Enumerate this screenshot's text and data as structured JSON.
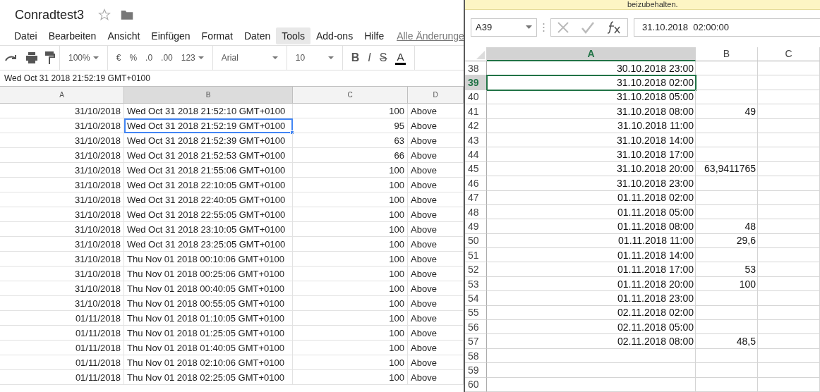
{
  "sheets": {
    "title": "Conradtest3",
    "menu": [
      {
        "label": "Datei",
        "selected": false
      },
      {
        "label": "Bearbeiten",
        "selected": false
      },
      {
        "label": "Ansicht",
        "selected": false
      },
      {
        "label": "Einfügen",
        "selected": false
      },
      {
        "label": "Format",
        "selected": false
      },
      {
        "label": "Daten",
        "selected": false
      },
      {
        "label": "Tools",
        "selected": true
      },
      {
        "label": "Add-ons",
        "selected": false
      },
      {
        "label": "Hilfe",
        "selected": false
      }
    ],
    "save_status": "Alle Änderunge",
    "toolbar": {
      "zoom": "100%",
      "currency": "€",
      "percent": "%",
      "decrease_decimals": ".0",
      "increase_decimals": ".00",
      "number_format": "123",
      "font": "Arial",
      "font_size": "10",
      "bold": "B",
      "italic": "I",
      "strike": "S",
      "text_color": "A"
    },
    "formula": "Wed Oct 31 2018 21:52:19 GMT+0100",
    "columns": [
      {
        "label": "A",
        "selected": false
      },
      {
        "label": "B",
        "selected": true
      },
      {
        "label": "C",
        "selected": false
      },
      {
        "label": "D",
        "selected": false
      }
    ],
    "rows": [
      {
        "cells": [
          "31/10/2018",
          "Wed Oct 31 2018 21:52:10 GMT+0100",
          "100",
          "Above"
        ],
        "selected": false
      },
      {
        "cells": [
          "31/10/2018",
          "Wed Oct 31 2018 21:52:19 GMT+0100",
          "95",
          "Above"
        ],
        "selected": true
      },
      {
        "cells": [
          "31/10/2018",
          "Wed Oct 31 2018 21:52:39 GMT+0100",
          "63",
          "Above"
        ],
        "selected": false
      },
      {
        "cells": [
          "31/10/2018",
          "Wed Oct 31 2018 21:52:53 GMT+0100",
          "66",
          "Above"
        ],
        "selected": false
      },
      {
        "cells": [
          "31/10/2018",
          "Wed Oct 31 2018 21:55:06 GMT+0100",
          "100",
          "Above"
        ],
        "selected": false
      },
      {
        "cells": [
          "31/10/2018",
          "Wed Oct 31 2018 22:10:05 GMT+0100",
          "100",
          "Above"
        ],
        "selected": false
      },
      {
        "cells": [
          "31/10/2018",
          "Wed Oct 31 2018 22:40:05 GMT+0100",
          "100",
          "Above"
        ],
        "selected": false
      },
      {
        "cells": [
          "31/10/2018",
          "Wed Oct 31 2018 22:55:05 GMT+0100",
          "100",
          "Above"
        ],
        "selected": false
      },
      {
        "cells": [
          "31/10/2018",
          "Wed Oct 31 2018 23:10:05 GMT+0100",
          "100",
          "Above"
        ],
        "selected": false
      },
      {
        "cells": [
          "31/10/2018",
          "Wed Oct 31 2018 23:25:05 GMT+0100",
          "100",
          "Above"
        ],
        "selected": false
      },
      {
        "cells": [
          "31/10/2018",
          "Thu Nov 01 2018 00:10:06 GMT+0100",
          "100",
          "Above"
        ],
        "selected": false
      },
      {
        "cells": [
          "31/10/2018",
          "Thu Nov 01 2018 00:25:06 GMT+0100",
          "100",
          "Above"
        ],
        "selected": false
      },
      {
        "cells": [
          "31/10/2018",
          "Thu Nov 01 2018 00:40:05 GMT+0100",
          "100",
          "Above"
        ],
        "selected": false
      },
      {
        "cells": [
          "31/10/2018",
          "Thu Nov 01 2018 00:55:05 GMT+0100",
          "100",
          "Above"
        ],
        "selected": false
      },
      {
        "cells": [
          "01/11/2018",
          "Thu Nov 01 2018 01:10:05 GMT+0100",
          "100",
          "Above"
        ],
        "selected": false
      },
      {
        "cells": [
          "01/11/2018",
          "Thu Nov 01 2018 01:25:05 GMT+0100",
          "100",
          "Above"
        ],
        "selected": false
      },
      {
        "cells": [
          "01/11/2018",
          "Thu Nov 01 2018 01:40:05 GMT+0100",
          "100",
          "Above"
        ],
        "selected": false
      },
      {
        "cells": [
          "01/11/2018",
          "Thu Nov 01 2018 02:10:06 GMT+0100",
          "100",
          "Above"
        ],
        "selected": false
      },
      {
        "cells": [
          "01/11/2018",
          "Thu Nov 01 2018 02:25:05 GMT+0100",
          "100",
          "Above"
        ],
        "selected": false
      }
    ]
  },
  "excel": {
    "notice": "beizubehalten.",
    "name_box": "A39",
    "formula": "31.10.2018  02:00:00",
    "columns": [
      {
        "label": "A",
        "selected": true
      },
      {
        "label": "B",
        "selected": false
      },
      {
        "label": "C",
        "selected": false
      }
    ],
    "rows": [
      {
        "number": "38",
        "cells": [
          "30.10.2018 23:00",
          ""
        ],
        "selected": false
      },
      {
        "number": "39",
        "cells": [
          "31.10.2018 02:00",
          ""
        ],
        "selected": true
      },
      {
        "number": "40",
        "cells": [
          "31.10.2018 05:00",
          ""
        ],
        "selected": false
      },
      {
        "number": "41",
        "cells": [
          "31.10.2018 08:00",
          "49"
        ],
        "selected": false
      },
      {
        "number": "42",
        "cells": [
          "31.10.2018 11:00",
          ""
        ],
        "selected": false
      },
      {
        "number": "43",
        "cells": [
          "31.10.2018 14:00",
          ""
        ],
        "selected": false
      },
      {
        "number": "44",
        "cells": [
          "31.10.2018 17:00",
          ""
        ],
        "selected": false
      },
      {
        "number": "45",
        "cells": [
          "31.10.2018 20:00",
          "63,9411765"
        ],
        "selected": false
      },
      {
        "number": "46",
        "cells": [
          "31.10.2018 23:00",
          ""
        ],
        "selected": false
      },
      {
        "number": "47",
        "cells": [
          "01.11.2018 02:00",
          ""
        ],
        "selected": false
      },
      {
        "number": "48",
        "cells": [
          "01.11.2018 05:00",
          ""
        ],
        "selected": false
      },
      {
        "number": "49",
        "cells": [
          "01.11.2018 08:00",
          "48"
        ],
        "selected": false
      },
      {
        "number": "50",
        "cells": [
          "01.11.2018 11:00",
          "29,6"
        ],
        "selected": false
      },
      {
        "number": "51",
        "cells": [
          "01.11.2018 14:00",
          ""
        ],
        "selected": false
      },
      {
        "number": "52",
        "cells": [
          "01.11.2018 17:00",
          "53"
        ],
        "selected": false
      },
      {
        "number": "53",
        "cells": [
          "01.11.2018 20:00",
          "100"
        ],
        "selected": false
      },
      {
        "number": "54",
        "cells": [
          "01.11.2018 23:00",
          ""
        ],
        "selected": false
      },
      {
        "number": "55",
        "cells": [
          "02.11.2018 02:00",
          ""
        ],
        "selected": false
      },
      {
        "number": "56",
        "cells": [
          "02.11.2018 05:00",
          ""
        ],
        "selected": false
      },
      {
        "number": "57",
        "cells": [
          "02.11.2018 08:00",
          "48,5"
        ],
        "selected": false
      },
      {
        "number": "58",
        "cells": [
          "",
          ""
        ],
        "selected": false
      },
      {
        "number": "59",
        "cells": [
          "",
          ""
        ],
        "selected": false
      },
      {
        "number": "60",
        "cells": [
          "",
          ""
        ],
        "selected": false
      }
    ]
  }
}
